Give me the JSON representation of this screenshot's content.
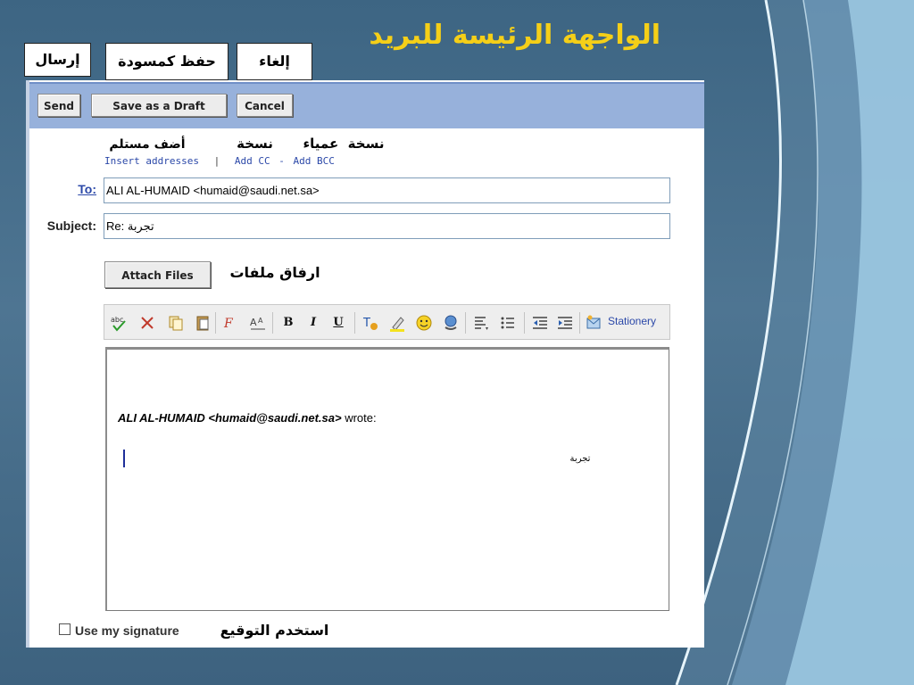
{
  "slide": {
    "title": "الواجهة الرئيسة للبريد",
    "callouts": {
      "send": "إرسال",
      "save_draft": "حفظ كمسودة",
      "cancel": "إلغاء",
      "add_recipient": "أضف مستلم",
      "cc": "نسخة",
      "bcc": "نسخة  عمياء",
      "attach": "ارفاق ملفات",
      "signature": "استخدم التوقيع"
    }
  },
  "toolbar": {
    "send_label": "Send",
    "save_draft_label": "Save as a Draft",
    "cancel_label": "Cancel"
  },
  "address_links": {
    "insert": "Insert addresses",
    "separator": "|",
    "add_cc": "Add CC",
    "dash": "-",
    "add_bcc": "Add BCC"
  },
  "compose": {
    "to_label": "To:",
    "to_value": "ALI AL-HUMAID <humaid@saudi.net.sa>",
    "subject_label": "Subject:",
    "subject_value": "Re: تجربة",
    "attach_label": "Attach Files"
  },
  "format_toolbar": {
    "icons": [
      "spellcheck-icon",
      "cut-icon",
      "copy-icon",
      "paste-icon",
      "font-icon",
      "font-size-icon",
      "bold-icon",
      "italic-icon",
      "underline-icon",
      "text-color-icon",
      "highlight-icon",
      "emoticon-icon",
      "hyperlink-icon",
      "align-icon",
      "bullets-icon",
      "outdent-icon",
      "indent-icon",
      "stationery-icon"
    ],
    "bold": "B",
    "italic": "I",
    "underline": "U",
    "stationery_label": "Stationery"
  },
  "editor": {
    "quote_name": "ALI AL-HUMAID <",
    "quote_email": "humaid@saudi.net.sa",
    "quote_close": ">",
    "quote_wrote": " wrote:",
    "body_text": "تجربة"
  },
  "signature": {
    "label": "Use my signature",
    "checked": false
  },
  "colors": {
    "slide_title": "#f5cf18",
    "toolbar_band": "#97b1db",
    "link": "#2b48a8"
  }
}
